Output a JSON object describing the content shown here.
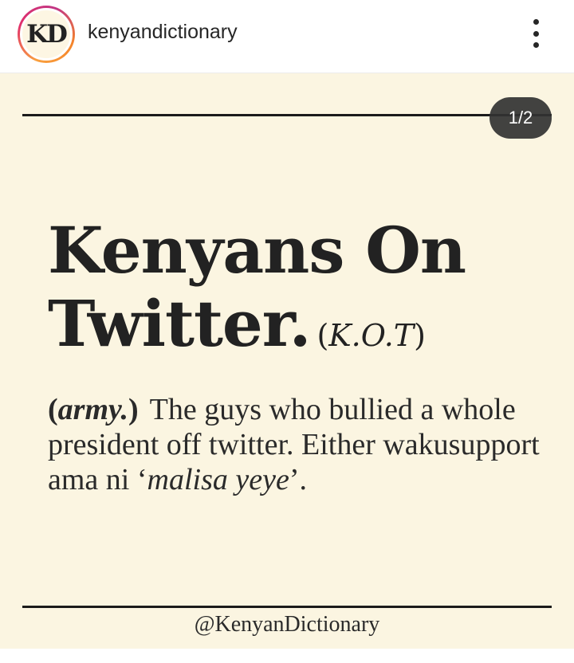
{
  "header": {
    "avatar_text": "KD",
    "username": "kenyandictionary",
    "more_icon": "more-vertical-icon"
  },
  "post": {
    "counter": "1/2",
    "title_line1": "Kenyans On",
    "title_line2": "Twitter.",
    "abbr_open": "(",
    "abbr": "K.O.T",
    "abbr_close": ")",
    "pos_open": "(",
    "pos": "army.",
    "pos_close": ")",
    "definition_main": "The guys who bullied a whole president off twitter. Either wakusupport ama ni ‘",
    "definition_italic": "malisa yeye",
    "definition_end": "’.",
    "handle": "@KenyanDictionary"
  },
  "colors": {
    "post_background": "#fbf5e1",
    "text": "#222222",
    "counter_background": "#323232"
  }
}
